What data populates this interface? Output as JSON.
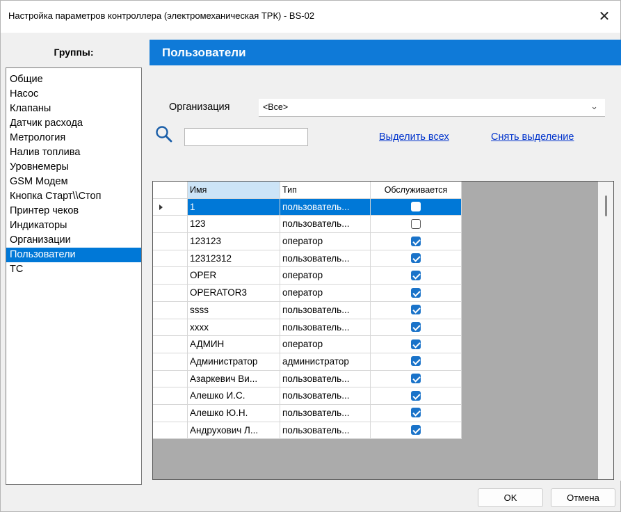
{
  "window": {
    "title": "Настройка параметров контроллера (электромеханическая ТРК) - BS-02",
    "close_glyph": "✕"
  },
  "sidebar": {
    "header": "Группы:",
    "items": [
      {
        "label": "Общие",
        "selected": false
      },
      {
        "label": "Насос",
        "selected": false
      },
      {
        "label": "Клапаны",
        "selected": false
      },
      {
        "label": "Датчик расхода",
        "selected": false
      },
      {
        "label": "Метрология",
        "selected": false
      },
      {
        "label": "Налив топлива",
        "selected": false
      },
      {
        "label": "Уровнемеры",
        "selected": false
      },
      {
        "label": "GSM Модем",
        "selected": false
      },
      {
        "label": "Кнопка Старт\\\\Стоп",
        "selected": false
      },
      {
        "label": "Принтер чеков",
        "selected": false
      },
      {
        "label": "Индикаторы",
        "selected": false
      },
      {
        "label": "Организации",
        "selected": false
      },
      {
        "label": "Пользователи",
        "selected": true
      },
      {
        "label": "ТС",
        "selected": false
      }
    ]
  },
  "panel": {
    "title": "Пользователи",
    "organization_label": "Организация",
    "organization_value": "<Все>",
    "search_value": "",
    "select_all_link": "Выделить всех",
    "deselect_link": "Снять выделение"
  },
  "table": {
    "columns": [
      "Имя",
      "Тип",
      "Обслуживается"
    ],
    "rows": [
      {
        "name": "1",
        "type": "пользователь...",
        "served": false,
        "selected": true
      },
      {
        "name": "123",
        "type": "пользователь...",
        "served": false,
        "selected": false
      },
      {
        "name": "123123",
        "type": "оператор",
        "served": true,
        "selected": false
      },
      {
        "name": "12312312",
        "type": "пользователь...",
        "served": true,
        "selected": false
      },
      {
        "name": "OPER",
        "type": "оператор",
        "served": true,
        "selected": false
      },
      {
        "name": "OPERATOR3",
        "type": "оператор",
        "served": true,
        "selected": false
      },
      {
        "name": "ssss",
        "type": "пользователь...",
        "served": true,
        "selected": false
      },
      {
        "name": "xxxx",
        "type": "пользователь...",
        "served": true,
        "selected": false
      },
      {
        "name": "АДМИН",
        "type": "оператор",
        "served": true,
        "selected": false
      },
      {
        "name": "Администратор",
        "type": "администратор",
        "served": true,
        "selected": false
      },
      {
        "name": "Азаркевич Ви...",
        "type": "пользователь...",
        "served": true,
        "selected": false
      },
      {
        "name": "Алешко И.С.",
        "type": "пользователь...",
        "served": true,
        "selected": false
      },
      {
        "name": "Алешко Ю.Н.",
        "type": "пользователь...",
        "served": true,
        "selected": false
      },
      {
        "name": "Андрухович Л...",
        "type": "пользователь...",
        "served": true,
        "selected": false
      }
    ]
  },
  "buttons": {
    "ok": "OK",
    "cancel": "Отмена"
  },
  "colors": {
    "accent": "#0078d7",
    "header_blue": "#0f7ad8",
    "link": "#0033cc"
  }
}
